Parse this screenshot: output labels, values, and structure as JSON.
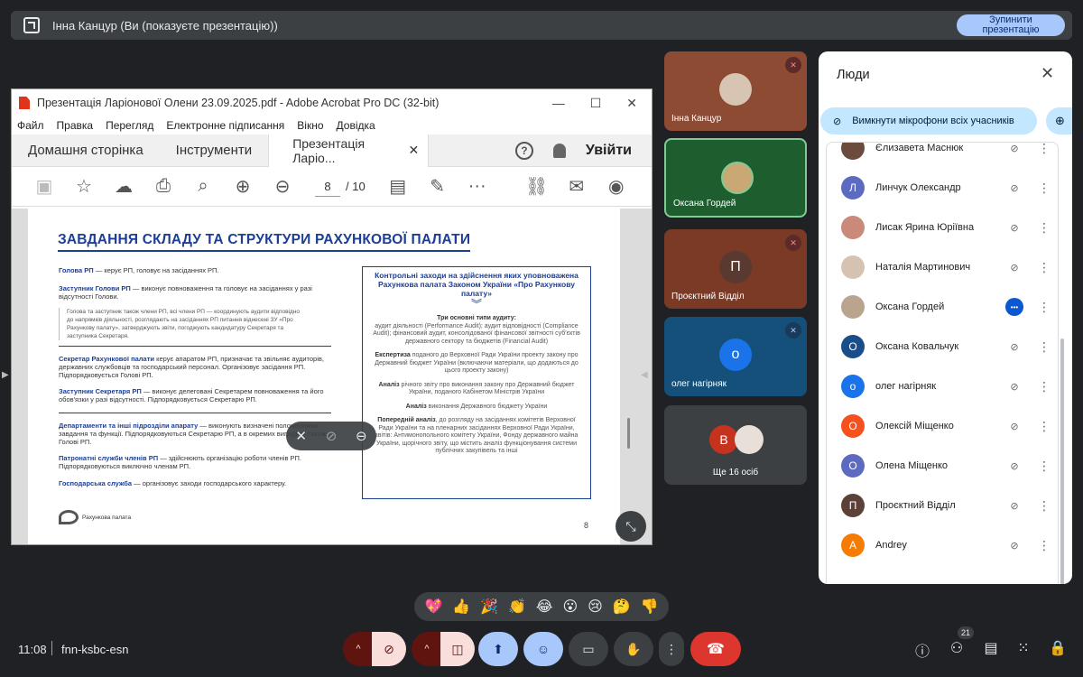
{
  "present_bar": {
    "title": "Інна Канцур (Ви (показуєте презентацію))",
    "stop_label": "Зупинити презентацію"
  },
  "acrobat": {
    "window_title": "Презентація Ларіонової Олени 23.09.2025.pdf - Adobe Acrobat Pro DC (32-bit)",
    "menu": [
      "Файл",
      "Правка",
      "Перегляд",
      "Електронне підписання",
      "Вікно",
      "Довідка"
    ],
    "tabs": {
      "home": "Домашня сторінка",
      "tools": "Інструменти",
      "doc": "Презентація Ларіо...",
      "signin": "Увійти"
    },
    "page_current": "8",
    "page_total": "/ 10"
  },
  "slide": {
    "heading": "ЗАВДАННЯ СКЛАДУ ТА СТРУКТУРИ РАХУНКОВОЇ ПАЛАТИ",
    "items": [
      {
        "title": "Голова РП",
        "text": " — керує РП, головує на засіданнях РП."
      },
      {
        "title": "Заступник Голови РП",
        "text": " — виконує повноваження та головує на засіданнях у разі відсутності Голови."
      },
      {
        "title": "",
        "text": "Голова та заступник також члени РП, всі члени РП — координують аудити відповідно до напрямків діяльності, розглядають на засіданнях РП питання віднесені ЗУ «Про Рахункову палату», затверджують звіти, погоджують кандидатуру Секретаря та заступника Секретаря."
      },
      {
        "title": "Секретар Рахункової палати",
        "text": " керує апаратом РП, призначає та звільняє аудиторів, державних службовців та господарський персонал. Організовує засідання РП. Підпорядковується Голові РП."
      },
      {
        "title": "Заступник Секретаря РП",
        "text": " — виконує делеговані Секретарем повноваження та його обов'язки у разі відсутності. Підпорядковується Секретарю РП."
      },
      {
        "title": "Департаменти та інші підрозділи апарату",
        "text": " — виконують визначені положеннями завдання та функції. Підпорядковуються Секретарю РП, а в окремих випадках також Голові РП."
      },
      {
        "title": "Патронатні служби членів РП",
        "text": " — здійснюють організацію роботи членів РП. Підпорядковуються виключно членам РП."
      },
      {
        "title": "Господарська служба",
        "text": " — організовує заходи господарського характеру."
      }
    ],
    "box_title": "Контрольні заходи на здійснення яких уповноважена Рахункова палата Законом України «Про Рахункову палату»",
    "box_blocks": [
      {
        "title": "Три основні типи аудиту:",
        "text": "аудит діяльності (Performance Audit); аудит відповідності (Compliance Audit); фінансовий аудит, консолідованої фінансової звітності суб'єктів державного сектору та бюджетів (Financial Audit)"
      },
      {
        "title": "Експертиза",
        "text": " поданого до Верховної Ради України проекту закону про Державний бюджет України (включаючи матеріали, що додаються до цього проекту закону)"
      },
      {
        "title": "Аналіз",
        "text": " річного звіту про виконання закону про Державний бюджет України, поданого Кабінетом Міністрів України"
      },
      {
        "title": "Аналіз",
        "text": " виконання Державного бюджету України"
      },
      {
        "title": "Попередній аналіз",
        "text": ", до розгляду на засіданнях комітетів Верховної Ради України та на пленарних засіданнях Верховної Ради України, звітів: Антимонопольного комітету України, Фонду державного майна України, щорічного звіту, що містить аналіз функціонування системи публічних закупівель та інші"
      }
    ],
    "logo_text": "Рахункова палата",
    "page_number": "8"
  },
  "tiles": [
    {
      "name": "Інна Канцур",
      "initial": "",
      "muted": true
    },
    {
      "name": "Оксана Гордей",
      "initial": "",
      "muted": false
    },
    {
      "name": "Проєктний Відділ",
      "initial": "П",
      "muted": true
    },
    {
      "name": "олег нагірняк",
      "initial": "о",
      "muted": true
    },
    {
      "name": "Ще 16 осіб",
      "initial": "В",
      "muted": false
    }
  ],
  "people_panel": {
    "title": "Люди",
    "mute_all": "Вимкнути мікрофони всіх учасників",
    "people": [
      {
        "name": "Єлизавета Маснюк",
        "initial": "",
        "color": "#6b4b3e"
      },
      {
        "name": "Линчук Олександр",
        "initial": "Л",
        "color": "#5c6bc0"
      },
      {
        "name": "Лисак Ярина Юріївна",
        "initial": "",
        "color": "#c98a7a"
      },
      {
        "name": "Наталія Мартинович",
        "initial": "",
        "color": "#d6c2b0"
      },
      {
        "name": "Оксана Гордей",
        "initial": "",
        "color": "#b9a58d"
      },
      {
        "name": "Оксана Ковальчук",
        "initial": "О",
        "color": "#1a4e8a"
      },
      {
        "name": "олег нагірняк",
        "initial": "о",
        "color": "#1a73e8"
      },
      {
        "name": "Олексій Міщенко",
        "initial": "О",
        "color": "#f4511e"
      },
      {
        "name": "Олена Міщенко",
        "initial": "О",
        "color": "#5c6bc0"
      },
      {
        "name": "Проєктний Відділ",
        "initial": "П",
        "color": "#5d4037"
      },
      {
        "name": "Andrey",
        "initial": "A",
        "color": "#f57c00"
      }
    ]
  },
  "reactions": [
    "💖",
    "👍",
    "🎉",
    "👏",
    "😂",
    "😮",
    "😢",
    "🤔",
    "👎"
  ],
  "bottom": {
    "time": "11:08",
    "meeting_code": "fnn-ksbc-esn",
    "people_count": "21"
  }
}
